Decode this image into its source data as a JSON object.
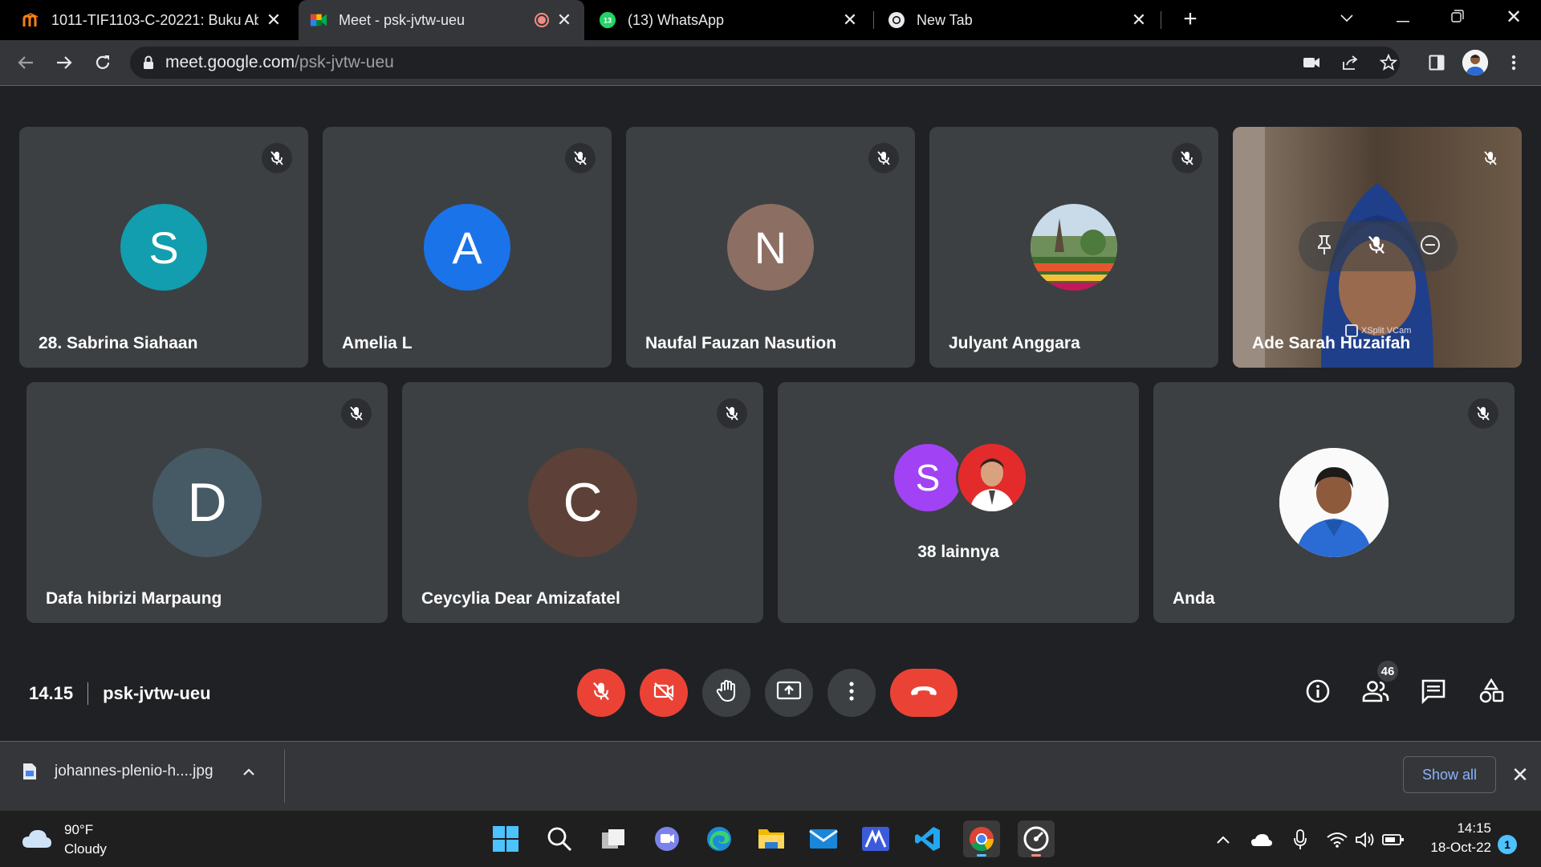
{
  "browser": {
    "tabs": [
      {
        "title": "1011-TIF1103-C-20221: Buku Ab",
        "active": false
      },
      {
        "title": "Meet - psk-jvtw-ueu",
        "active": true
      },
      {
        "title": "(13) WhatsApp",
        "active": false,
        "badge": "13"
      },
      {
        "title": "New Tab",
        "active": false
      }
    ],
    "url_host": "meet.google.com",
    "url_path": "/psk-jvtw-ueu"
  },
  "meet": {
    "participants": [
      {
        "name": "28. Sabrina Siahaan",
        "initial": "S",
        "color": "#129eaf"
      },
      {
        "name": "Amelia L",
        "initial": "A",
        "color": "#1a73e8"
      },
      {
        "name": "Naufal Fauzan Nasution",
        "initial": "N",
        "color": "#8d6e63"
      },
      {
        "name": "Julyant Anggara",
        "initial": "",
        "avatar": "garden-photo"
      },
      {
        "name": "Ade Sarah Huzaifah",
        "initial": "",
        "video": true,
        "overlay_text": "XSplit VCam"
      },
      {
        "name": "Dafa hibrizi Marpaung",
        "initial": "D",
        "color": "#455a64"
      },
      {
        "name": "Ceycylia Dear Amizafatel",
        "initial": "C",
        "color": "#5d4037"
      },
      {
        "name": "Anda",
        "initial": "",
        "avatar": "profile-photo"
      }
    ],
    "others": {
      "label": "38 lainnya",
      "initial": "S",
      "color": "#a142f4"
    },
    "time": "14.15",
    "meeting_code": "psk-jvtw-ueu",
    "participant_count": "46"
  },
  "download": {
    "filename": "johannes-plenio-h....jpg",
    "show_all": "Show all"
  },
  "taskbar": {
    "temperature": "90°F",
    "condition": "Cloudy",
    "time": "14:15",
    "date": "18-Oct-22",
    "notifications": "1"
  },
  "colors": {
    "accent_red": "#ea4335",
    "link_blue": "#8ab4f8",
    "tile_bg": "#3c4043",
    "page_bg": "#202124"
  }
}
